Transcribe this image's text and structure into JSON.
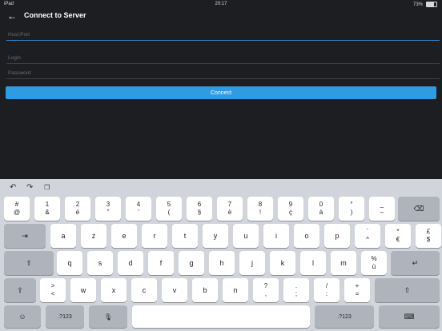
{
  "status": {
    "carrier": "iPad",
    "time": "20:17",
    "battery": "73%",
    "battery_level": 0.73
  },
  "app": {
    "title": "Connect to Server",
    "back_icon": "arrow-left-icon"
  },
  "form": {
    "host_placeholder": "Host:Port",
    "login_placeholder": "Login",
    "password_placeholder": "Password",
    "connect_label": "Connect"
  },
  "keyboard": {
    "toolbar": [
      "undo-icon",
      "redo-icon",
      "paste-icon"
    ],
    "row1": [
      {
        "t": "#",
        "b": "@"
      },
      {
        "t": "1",
        "b": "&"
      },
      {
        "t": "2",
        "b": "é"
      },
      {
        "t": "3",
        "b": "\""
      },
      {
        "t": "4",
        "b": "'"
      },
      {
        "t": "5",
        "b": "("
      },
      {
        "t": "6",
        "b": "§"
      },
      {
        "t": "7",
        "b": "è"
      },
      {
        "t": "8",
        "b": "!"
      },
      {
        "t": "9",
        "b": "ç"
      },
      {
        "t": "0",
        "b": "à"
      },
      {
        "t": "°",
        "b": ")"
      },
      {
        "t": "_",
        "b": "–"
      }
    ],
    "row2": [
      {
        "s": "a"
      },
      {
        "s": "z"
      },
      {
        "s": "e"
      },
      {
        "s": "r"
      },
      {
        "s": "t"
      },
      {
        "s": "y"
      },
      {
        "s": "u"
      },
      {
        "s": "i"
      },
      {
        "s": "o"
      },
      {
        "s": "p"
      },
      {
        "t": "¨",
        "b": "^"
      },
      {
        "t": "*",
        "b": "€"
      },
      {
        "t": "£",
        "b": "$"
      }
    ],
    "row3": [
      {
        "s": "q"
      },
      {
        "s": "s"
      },
      {
        "s": "d"
      },
      {
        "s": "f"
      },
      {
        "s": "g"
      },
      {
        "s": "h"
      },
      {
        "s": "j"
      },
      {
        "s": "k"
      },
      {
        "s": "l"
      },
      {
        "s": "m"
      },
      {
        "t": "%",
        "b": "ù"
      },
      {
        "t": "£",
        "b": "`"
      }
    ],
    "row4": [
      {
        "t": ">",
        "b": "<"
      },
      {
        "s": "w"
      },
      {
        "s": "x"
      },
      {
        "s": "c"
      },
      {
        "s": "v"
      },
      {
        "s": "b"
      },
      {
        "s": "n"
      },
      {
        "t": "?",
        "b": ","
      },
      {
        "t": ".",
        "b": ";"
      },
      {
        "t": "/",
        "b": ":"
      },
      {
        "t": "+",
        "b": "="
      }
    ],
    "tab_icon": "tab-arrow-icon",
    "shift_icon": "shift-icon",
    "delete_icon": "backspace-icon",
    "return_icon": "return-icon",
    "globe_icon": "globe-icon",
    "mic_icon": "microphone-icon",
    "hide_icon": "keyboard-hide-icon",
    "numbers_label": ".?123"
  }
}
